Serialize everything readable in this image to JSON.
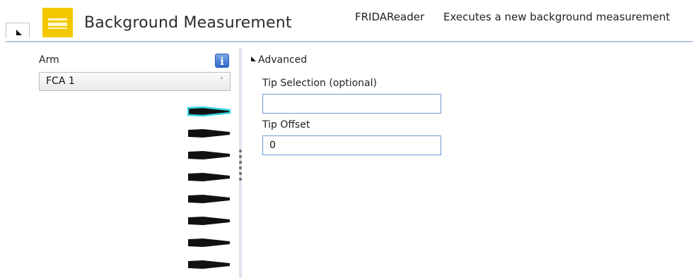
{
  "header": {
    "title": "Background Measurement",
    "app_name": "FRIDAReader",
    "description": "Executes a new background measurement",
    "logo_icon": "yellow-brand-logo",
    "collapse_icon": "triangle-collapse-icon"
  },
  "left_pane": {
    "arm_label": "Arm",
    "info_glyph": "i",
    "arm_select": {
      "selected": "FCA 1",
      "chevron": "˅"
    },
    "tips": [
      {
        "index": 1,
        "selected": true
      },
      {
        "index": 2,
        "selected": false
      },
      {
        "index": 3,
        "selected": false
      },
      {
        "index": 4,
        "selected": false
      },
      {
        "index": 5,
        "selected": false
      },
      {
        "index": 6,
        "selected": false
      },
      {
        "index": 7,
        "selected": false
      },
      {
        "index": 8,
        "selected": false
      }
    ]
  },
  "right_pane": {
    "advanced_label": "Advanced",
    "tip_selection": {
      "label": "Tip Selection (optional)",
      "value": ""
    },
    "tip_offset": {
      "label": "Tip Offset",
      "value": "0"
    }
  },
  "colors": {
    "accent_blue": "#6b9ad3",
    "logo_yellow": "#f4c800",
    "tip_highlight": "#35d4df"
  }
}
